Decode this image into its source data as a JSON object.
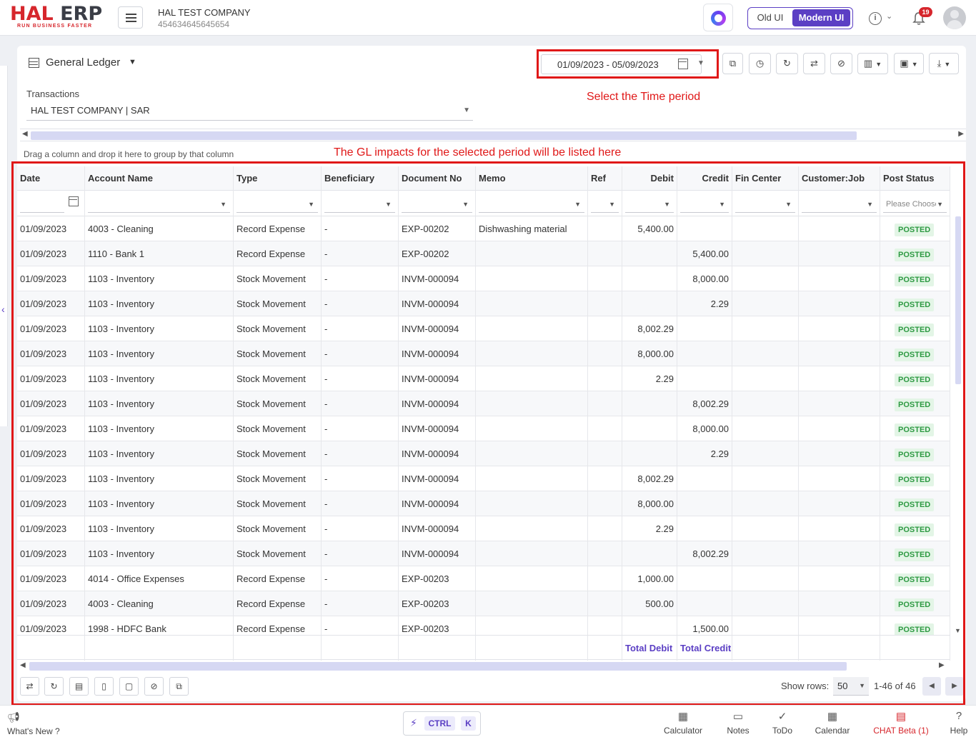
{
  "topbar": {
    "logo_text_a": "HAL",
    "logo_text_b": "ERP",
    "logo_tagline": "RUN BUSINESS FASTER",
    "company_name": "HAL TEST COMPANY",
    "company_id": "454634645645654",
    "old_ui_label": "Old UI",
    "modern_ui_label": "Modern UI",
    "notification_count": "19"
  },
  "page": {
    "title": "General Ledger",
    "date_range": "01/09/2023 - 05/09/2023",
    "transactions_label": "Transactions",
    "transactions_value": "HAL TEST COMPANY | SAR",
    "group_hint": "Drag a column and drop it here to group by that column",
    "annotation_time": "Select the Time period",
    "annotation_gl": "The GL impacts for the selected period will be listed here"
  },
  "grid": {
    "columns": [
      "Date",
      "Account Name",
      "Type",
      "Beneficiary",
      "Document No",
      "Memo",
      "Ref",
      "Debit",
      "Credit",
      "Fin Center",
      "Customer:Job",
      "Post Status"
    ],
    "status_filter_placeholder": "Please Choose",
    "rows": [
      {
        "date": "01/09/2023",
        "account": "4003 - Cleaning",
        "type": "Record Expense",
        "beneficiary": "-",
        "doc": "EXP-00202",
        "memo": "Dishwashing material",
        "ref": "",
        "debit": "5,400.00",
        "credit": "",
        "status": "POSTED"
      },
      {
        "date": "01/09/2023",
        "account": "1110 - Bank 1",
        "type": "Record Expense",
        "beneficiary": "-",
        "doc": "EXP-00202",
        "memo": "",
        "ref": "",
        "debit": "",
        "credit": "5,400.00",
        "status": "POSTED"
      },
      {
        "date": "01/09/2023",
        "account": "1103 - Inventory",
        "type": "Stock Movement",
        "beneficiary": "-",
        "doc": "INVM-000094",
        "memo": "",
        "ref": "",
        "debit": "",
        "credit": "8,000.00",
        "status": "POSTED"
      },
      {
        "date": "01/09/2023",
        "account": "1103 - Inventory",
        "type": "Stock Movement",
        "beneficiary": "-",
        "doc": "INVM-000094",
        "memo": "",
        "ref": "",
        "debit": "",
        "credit": "2.29",
        "status": "POSTED"
      },
      {
        "date": "01/09/2023",
        "account": "1103 - Inventory",
        "type": "Stock Movement",
        "beneficiary": "-",
        "doc": "INVM-000094",
        "memo": "",
        "ref": "",
        "debit": "8,002.29",
        "credit": "",
        "status": "POSTED"
      },
      {
        "date": "01/09/2023",
        "account": "1103 - Inventory",
        "type": "Stock Movement",
        "beneficiary": "-",
        "doc": "INVM-000094",
        "memo": "",
        "ref": "",
        "debit": "8,000.00",
        "credit": "",
        "status": "POSTED"
      },
      {
        "date": "01/09/2023",
        "account": "1103 - Inventory",
        "type": "Stock Movement",
        "beneficiary": "-",
        "doc": "INVM-000094",
        "memo": "",
        "ref": "",
        "debit": "2.29",
        "credit": "",
        "status": "POSTED"
      },
      {
        "date": "01/09/2023",
        "account": "1103 - Inventory",
        "type": "Stock Movement",
        "beneficiary": "-",
        "doc": "INVM-000094",
        "memo": "",
        "ref": "",
        "debit": "",
        "credit": "8,002.29",
        "status": "POSTED"
      },
      {
        "date": "01/09/2023",
        "account": "1103 - Inventory",
        "type": "Stock Movement",
        "beneficiary": "-",
        "doc": "INVM-000094",
        "memo": "",
        "ref": "",
        "debit": "",
        "credit": "8,000.00",
        "status": "POSTED"
      },
      {
        "date": "01/09/2023",
        "account": "1103 - Inventory",
        "type": "Stock Movement",
        "beneficiary": "-",
        "doc": "INVM-000094",
        "memo": "",
        "ref": "",
        "debit": "",
        "credit": "2.29",
        "status": "POSTED"
      },
      {
        "date": "01/09/2023",
        "account": "1103 - Inventory",
        "type": "Stock Movement",
        "beneficiary": "-",
        "doc": "INVM-000094",
        "memo": "",
        "ref": "",
        "debit": "8,002.29",
        "credit": "",
        "status": "POSTED"
      },
      {
        "date": "01/09/2023",
        "account": "1103 - Inventory",
        "type": "Stock Movement",
        "beneficiary": "-",
        "doc": "INVM-000094",
        "memo": "",
        "ref": "",
        "debit": "8,000.00",
        "credit": "",
        "status": "POSTED"
      },
      {
        "date": "01/09/2023",
        "account": "1103 - Inventory",
        "type": "Stock Movement",
        "beneficiary": "-",
        "doc": "INVM-000094",
        "memo": "",
        "ref": "",
        "debit": "2.29",
        "credit": "",
        "status": "POSTED"
      },
      {
        "date": "01/09/2023",
        "account": "1103 - Inventory",
        "type": "Stock Movement",
        "beneficiary": "-",
        "doc": "INVM-000094",
        "memo": "",
        "ref": "",
        "debit": "",
        "credit": "8,002.29",
        "status": "POSTED"
      },
      {
        "date": "01/09/2023",
        "account": "4014 - Office Expenses",
        "type": "Record Expense",
        "beneficiary": "-",
        "doc": "EXP-00203",
        "memo": "",
        "ref": "",
        "debit": "1,000.00",
        "credit": "",
        "status": "POSTED"
      },
      {
        "date": "01/09/2023",
        "account": "4003 - Cleaning",
        "type": "Record Expense",
        "beneficiary": "-",
        "doc": "EXP-00203",
        "memo": "",
        "ref": "",
        "debit": "500.00",
        "credit": "",
        "status": "POSTED"
      },
      {
        "date": "01/09/2023",
        "account": "1998 - HDFC Bank",
        "type": "Record Expense",
        "beneficiary": "-",
        "doc": "EXP-00203",
        "memo": "",
        "ref": "",
        "debit": "",
        "credit": "1,500.00",
        "status": "POSTED"
      }
    ],
    "total_debit_label": "Total Debit",
    "total_credit_label": "Total Credit"
  },
  "pager": {
    "show_rows_label": "Show rows:",
    "rows_per_page": "50",
    "range_text": "1-46 of 46"
  },
  "bottombar": {
    "whats_new": "What's New ?",
    "ctrl": "CTRL",
    "k": "K",
    "calculator": "Calculator",
    "notes": "Notes",
    "todo": "ToDo",
    "calendar": "Calendar",
    "chat": "CHAT Beta (1)",
    "help": "Help"
  },
  "colors": {
    "brand_red": "#d6262c",
    "accent_purple": "#5b3fc4",
    "posted_green": "#2e9a43",
    "annotation_red": "#e01818"
  }
}
